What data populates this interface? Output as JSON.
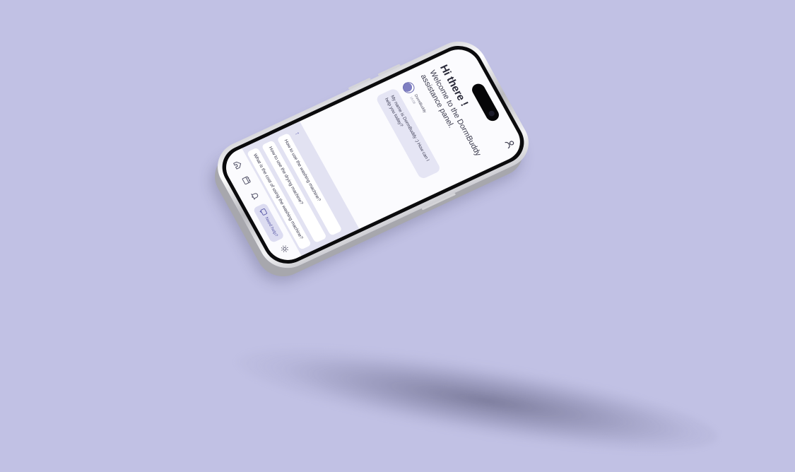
{
  "colors": {
    "background": "#c1c1e4",
    "accent": "#6a6ab0",
    "panel": "#e2e2f2"
  },
  "header": {
    "profile_icon": "user-icon"
  },
  "greeting": {
    "title": "Hi there !",
    "subtitle": "Welcome to the DormBuddy assistance panel."
  },
  "bot": {
    "name": "DormBuddy",
    "time": "16:08"
  },
  "message": {
    "text": "My name is DormBuddy :) How can I help you today?"
  },
  "suggestions": {
    "back_icon": "up-arrow-icon",
    "items": [
      "How to use the washing machine?",
      "How to use the drying machine?",
      "What is the cost of using the washing machine?"
    ]
  },
  "nav": {
    "items": [
      {
        "icon": "home-icon"
      },
      {
        "icon": "calendar-icon"
      },
      {
        "icon": "bell-icon"
      },
      {
        "icon": "settings-icon"
      }
    ],
    "help_label": "Need help?",
    "help_icon": "chat-help-icon"
  }
}
